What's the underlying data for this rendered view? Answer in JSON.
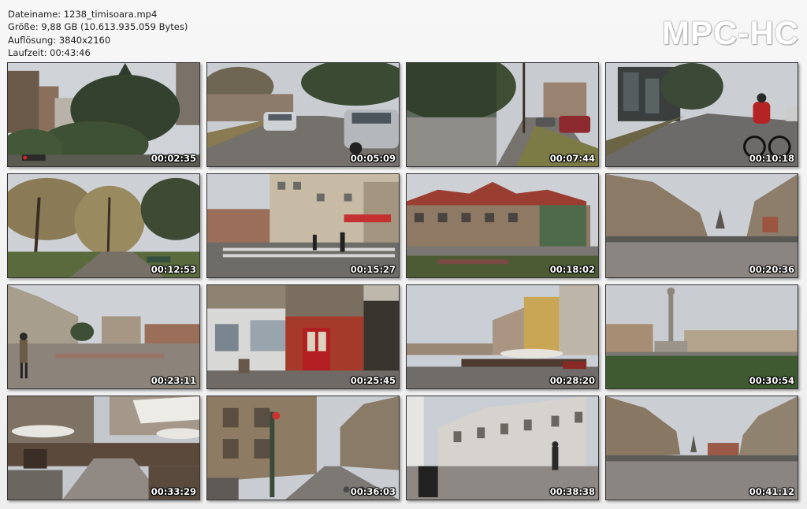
{
  "info": {
    "filename": "Dateiname: 1238_timisoara.mp4",
    "size": "Größe: 9,88 GB (10.613.935.059 Bytes)",
    "resolution": "Auflösung: 3840x2160",
    "duration": "Laufzeit: 00:43:46"
  },
  "logo": "MPC-HC",
  "thumbnails": [
    {
      "time": "00:02:35",
      "scene": "park-trees"
    },
    {
      "time": "00:05:09",
      "scene": "street-cars"
    },
    {
      "time": "00:07:44",
      "scene": "sidewalk-fence"
    },
    {
      "time": "00:10:18",
      "scene": "cyclist"
    },
    {
      "time": "00:12:53",
      "scene": "autumn-park"
    },
    {
      "time": "00:15:27",
      "scene": "crosswalk"
    },
    {
      "time": "00:18:02",
      "scene": "red-roof-building"
    },
    {
      "time": "00:20:36",
      "scene": "square-wide"
    },
    {
      "time": "00:23:11",
      "scene": "square-walker"
    },
    {
      "time": "00:25:45",
      "scene": "storefront"
    },
    {
      "time": "00:28:20",
      "scene": "cafe-terrace"
    },
    {
      "time": "00:30:54",
      "scene": "column-square"
    },
    {
      "time": "00:33:29",
      "scene": "cafe-umbrellas"
    },
    {
      "time": "00:36:03",
      "scene": "narrow-street"
    },
    {
      "time": "00:38:38",
      "scene": "white-building"
    },
    {
      "time": "00:41:12",
      "scene": "square-cathedral"
    }
  ],
  "colors": {
    "sky": "#c9cdd2",
    "ground": "#8b8680",
    "building": "#a89a86",
    "tree": "#3d4a35",
    "accent_red": "#b32828"
  }
}
